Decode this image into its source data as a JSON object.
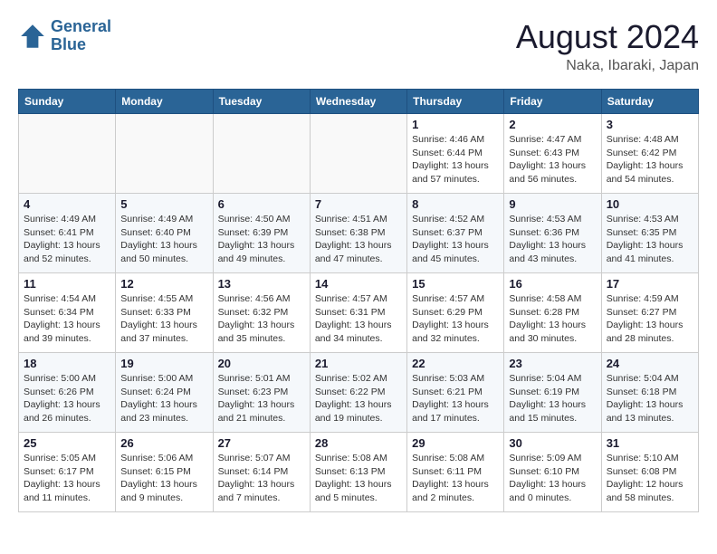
{
  "header": {
    "logo_line1": "General",
    "logo_line2": "Blue",
    "title": "August 2024",
    "subtitle": "Naka, Ibaraki, Japan"
  },
  "days_of_week": [
    "Sunday",
    "Monday",
    "Tuesday",
    "Wednesday",
    "Thursday",
    "Friday",
    "Saturday"
  ],
  "weeks": [
    [
      {
        "day": "",
        "info": ""
      },
      {
        "day": "",
        "info": ""
      },
      {
        "day": "",
        "info": ""
      },
      {
        "day": "",
        "info": ""
      },
      {
        "day": "1",
        "info": "Sunrise: 4:46 AM\nSunset: 6:44 PM\nDaylight: 13 hours\nand 57 minutes."
      },
      {
        "day": "2",
        "info": "Sunrise: 4:47 AM\nSunset: 6:43 PM\nDaylight: 13 hours\nand 56 minutes."
      },
      {
        "day": "3",
        "info": "Sunrise: 4:48 AM\nSunset: 6:42 PM\nDaylight: 13 hours\nand 54 minutes."
      }
    ],
    [
      {
        "day": "4",
        "info": "Sunrise: 4:49 AM\nSunset: 6:41 PM\nDaylight: 13 hours\nand 52 minutes."
      },
      {
        "day": "5",
        "info": "Sunrise: 4:49 AM\nSunset: 6:40 PM\nDaylight: 13 hours\nand 50 minutes."
      },
      {
        "day": "6",
        "info": "Sunrise: 4:50 AM\nSunset: 6:39 PM\nDaylight: 13 hours\nand 49 minutes."
      },
      {
        "day": "7",
        "info": "Sunrise: 4:51 AM\nSunset: 6:38 PM\nDaylight: 13 hours\nand 47 minutes."
      },
      {
        "day": "8",
        "info": "Sunrise: 4:52 AM\nSunset: 6:37 PM\nDaylight: 13 hours\nand 45 minutes."
      },
      {
        "day": "9",
        "info": "Sunrise: 4:53 AM\nSunset: 6:36 PM\nDaylight: 13 hours\nand 43 minutes."
      },
      {
        "day": "10",
        "info": "Sunrise: 4:53 AM\nSunset: 6:35 PM\nDaylight: 13 hours\nand 41 minutes."
      }
    ],
    [
      {
        "day": "11",
        "info": "Sunrise: 4:54 AM\nSunset: 6:34 PM\nDaylight: 13 hours\nand 39 minutes."
      },
      {
        "day": "12",
        "info": "Sunrise: 4:55 AM\nSunset: 6:33 PM\nDaylight: 13 hours\nand 37 minutes."
      },
      {
        "day": "13",
        "info": "Sunrise: 4:56 AM\nSunset: 6:32 PM\nDaylight: 13 hours\nand 35 minutes."
      },
      {
        "day": "14",
        "info": "Sunrise: 4:57 AM\nSunset: 6:31 PM\nDaylight: 13 hours\nand 34 minutes."
      },
      {
        "day": "15",
        "info": "Sunrise: 4:57 AM\nSunset: 6:29 PM\nDaylight: 13 hours\nand 32 minutes."
      },
      {
        "day": "16",
        "info": "Sunrise: 4:58 AM\nSunset: 6:28 PM\nDaylight: 13 hours\nand 30 minutes."
      },
      {
        "day": "17",
        "info": "Sunrise: 4:59 AM\nSunset: 6:27 PM\nDaylight: 13 hours\nand 28 minutes."
      }
    ],
    [
      {
        "day": "18",
        "info": "Sunrise: 5:00 AM\nSunset: 6:26 PM\nDaylight: 13 hours\nand 26 minutes."
      },
      {
        "day": "19",
        "info": "Sunrise: 5:00 AM\nSunset: 6:24 PM\nDaylight: 13 hours\nand 23 minutes."
      },
      {
        "day": "20",
        "info": "Sunrise: 5:01 AM\nSunset: 6:23 PM\nDaylight: 13 hours\nand 21 minutes."
      },
      {
        "day": "21",
        "info": "Sunrise: 5:02 AM\nSunset: 6:22 PM\nDaylight: 13 hours\nand 19 minutes."
      },
      {
        "day": "22",
        "info": "Sunrise: 5:03 AM\nSunset: 6:21 PM\nDaylight: 13 hours\nand 17 minutes."
      },
      {
        "day": "23",
        "info": "Sunrise: 5:04 AM\nSunset: 6:19 PM\nDaylight: 13 hours\nand 15 minutes."
      },
      {
        "day": "24",
        "info": "Sunrise: 5:04 AM\nSunset: 6:18 PM\nDaylight: 13 hours\nand 13 minutes."
      }
    ],
    [
      {
        "day": "25",
        "info": "Sunrise: 5:05 AM\nSunset: 6:17 PM\nDaylight: 13 hours\nand 11 minutes."
      },
      {
        "day": "26",
        "info": "Sunrise: 5:06 AM\nSunset: 6:15 PM\nDaylight: 13 hours\nand 9 minutes."
      },
      {
        "day": "27",
        "info": "Sunrise: 5:07 AM\nSunset: 6:14 PM\nDaylight: 13 hours\nand 7 minutes."
      },
      {
        "day": "28",
        "info": "Sunrise: 5:08 AM\nSunset: 6:13 PM\nDaylight: 13 hours\nand 5 minutes."
      },
      {
        "day": "29",
        "info": "Sunrise: 5:08 AM\nSunset: 6:11 PM\nDaylight: 13 hours\nand 2 minutes."
      },
      {
        "day": "30",
        "info": "Sunrise: 5:09 AM\nSunset: 6:10 PM\nDaylight: 13 hours\nand 0 minutes."
      },
      {
        "day": "31",
        "info": "Sunrise: 5:10 AM\nSunset: 6:08 PM\nDaylight: 12 hours\nand 58 minutes."
      }
    ]
  ]
}
